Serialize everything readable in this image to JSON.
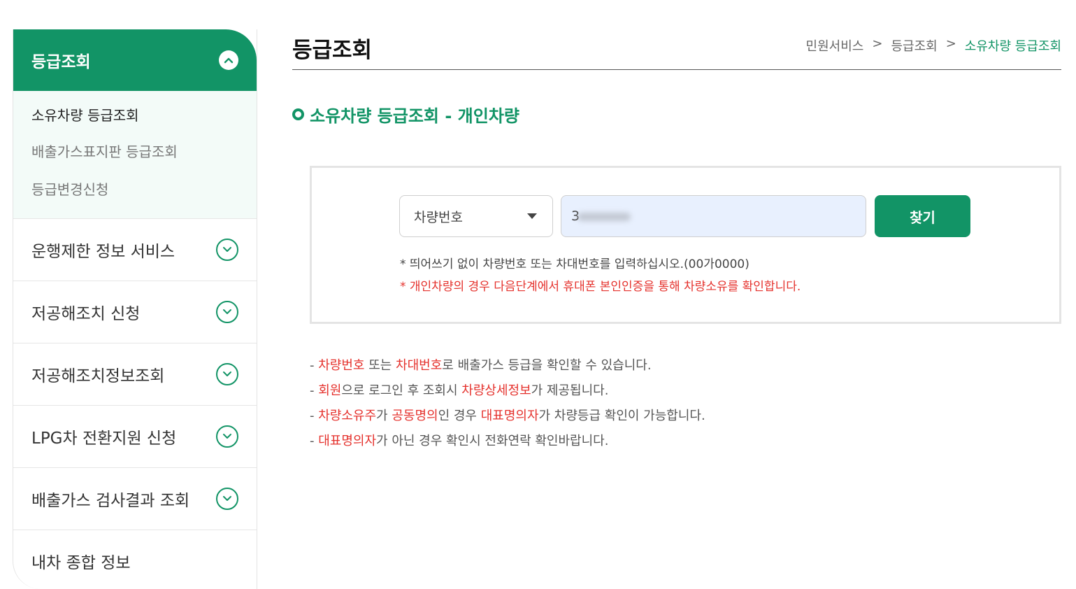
{
  "sidebar": {
    "header": "등급조회",
    "submenu": [
      {
        "label": "소유차량 등급조회"
      },
      {
        "label": "배출가스표지판 등급조회"
      },
      {
        "label": "등급변경신청"
      }
    ],
    "menu": [
      {
        "label": "운행제한 정보 서비스"
      },
      {
        "label": "저공해조치 신청"
      },
      {
        "label": "저공해조치정보조회"
      },
      {
        "label": "LPG차 전환지원 신청"
      },
      {
        "label": "배출가스 검사결과 조회"
      },
      {
        "label": "내차 종합 정보"
      }
    ]
  },
  "header": {
    "title": "등급조회",
    "breadcrumb": [
      "민원서비스",
      "등급조회",
      "소유차량 등급조회"
    ],
    "separator": ">"
  },
  "section": {
    "title": "소유차량 등급조회 - 개인차량"
  },
  "search": {
    "select_value": "차량번호",
    "input_value": "3",
    "button_label": "찾기",
    "hint1": "* 띄어쓰기 없이 차량번호 또는 차대번호를 입력하십시오.(00가0000)",
    "hint2": "* 개인차량의 경우 다음단계에서 휴대폰 본인인증을 통해 차량소유를 확인합니다."
  },
  "notes": [
    {
      "parts": [
        {
          "text": "- ",
          "red": false
        },
        {
          "text": "차량번호",
          "red": true
        },
        {
          "text": " 또는 ",
          "red": false
        },
        {
          "text": "차대번호",
          "red": true
        },
        {
          "text": "로 배출가스 등급을 확인할 수 있습니다.",
          "red": false
        }
      ]
    },
    {
      "parts": [
        {
          "text": "- ",
          "red": false
        },
        {
          "text": "회원",
          "red": true
        },
        {
          "text": "으로 로그인 후 조회시 ",
          "red": false
        },
        {
          "text": "차량상세정보",
          "red": true
        },
        {
          "text": "가 제공됩니다.",
          "red": false
        }
      ]
    },
    {
      "parts": [
        {
          "text": "- ",
          "red": false
        },
        {
          "text": "차량소유주",
          "red": true
        },
        {
          "text": "가 ",
          "red": false
        },
        {
          "text": "공동명의",
          "red": true
        },
        {
          "text": "인 경우 ",
          "red": false
        },
        {
          "text": "대표명의자",
          "red": true
        },
        {
          "text": "가 차량등급 확인이 가능합니다.",
          "red": false
        }
      ]
    },
    {
      "parts": [
        {
          "text": "- ",
          "red": false
        },
        {
          "text": "대표명의자",
          "red": true
        },
        {
          "text": "가 아닌 경우 확인시 전화연락 확인바랍니다.",
          "red": false
        }
      ]
    }
  ],
  "colors": {
    "brand": "#129466",
    "warning": "#e5322d",
    "input_bg": "#e8f0fe"
  },
  "icons": {
    "expanded": "chevron-up-icon",
    "collapsed": "chevron-down-icon",
    "section_marker": "ring-icon",
    "select_caret": "caret-down-icon"
  }
}
